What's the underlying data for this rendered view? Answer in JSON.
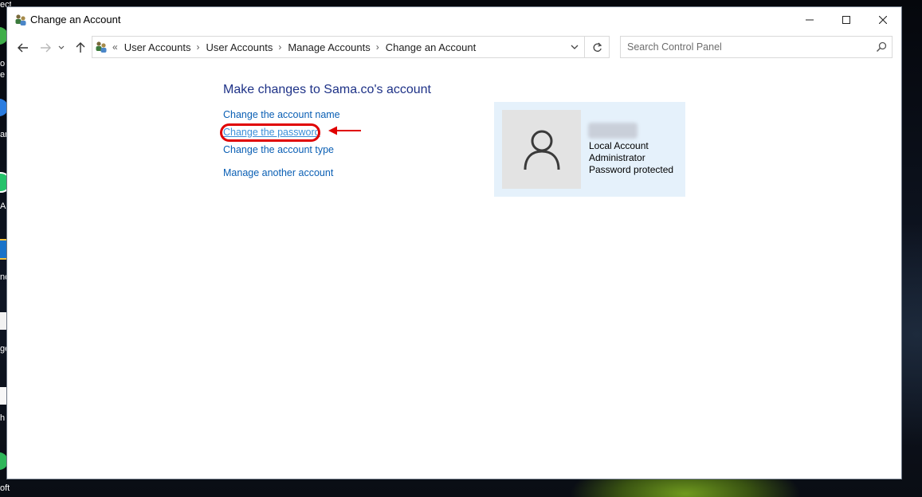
{
  "window": {
    "title": "Change an Account",
    "controls": {
      "minimize": "minimize",
      "maximize": "maximize",
      "close": "close"
    }
  },
  "address_bar": {
    "overflow": "«",
    "crumbs": [
      "User Accounts",
      "User Accounts",
      "Manage Accounts",
      "Change an Account"
    ]
  },
  "search": {
    "placeholder": "Search Control Panel"
  },
  "main": {
    "heading": "Make changes to Sama.co's account",
    "tasks": [
      {
        "label": "Change the account name"
      },
      {
        "label": "Change the password",
        "highlighted": true
      },
      {
        "label": "Change the account type"
      },
      {
        "label": "Manage another account"
      }
    ]
  },
  "account": {
    "lines": [
      "Local Account",
      "Administrator",
      "Password protected"
    ]
  },
  "desktop": {
    "labels": [
      "ect",
      "o",
      "e",
      "ar",
      "Ap",
      "nc",
      "ge",
      "h",
      "oft"
    ]
  },
  "colors": {
    "link": "#0a5fb4",
    "heading": "#1e3287",
    "highlight": "#e00000",
    "card_bg": "#e5f1fb"
  },
  "icons": [
    "user-accounts-icon",
    "back-arrow-icon",
    "forward-arrow-icon",
    "recent-chevron-icon",
    "up-arrow-icon",
    "dropdown-chevron-icon",
    "refresh-icon",
    "search-icon",
    "user-avatar-icon",
    "red-arrow-icon"
  ]
}
